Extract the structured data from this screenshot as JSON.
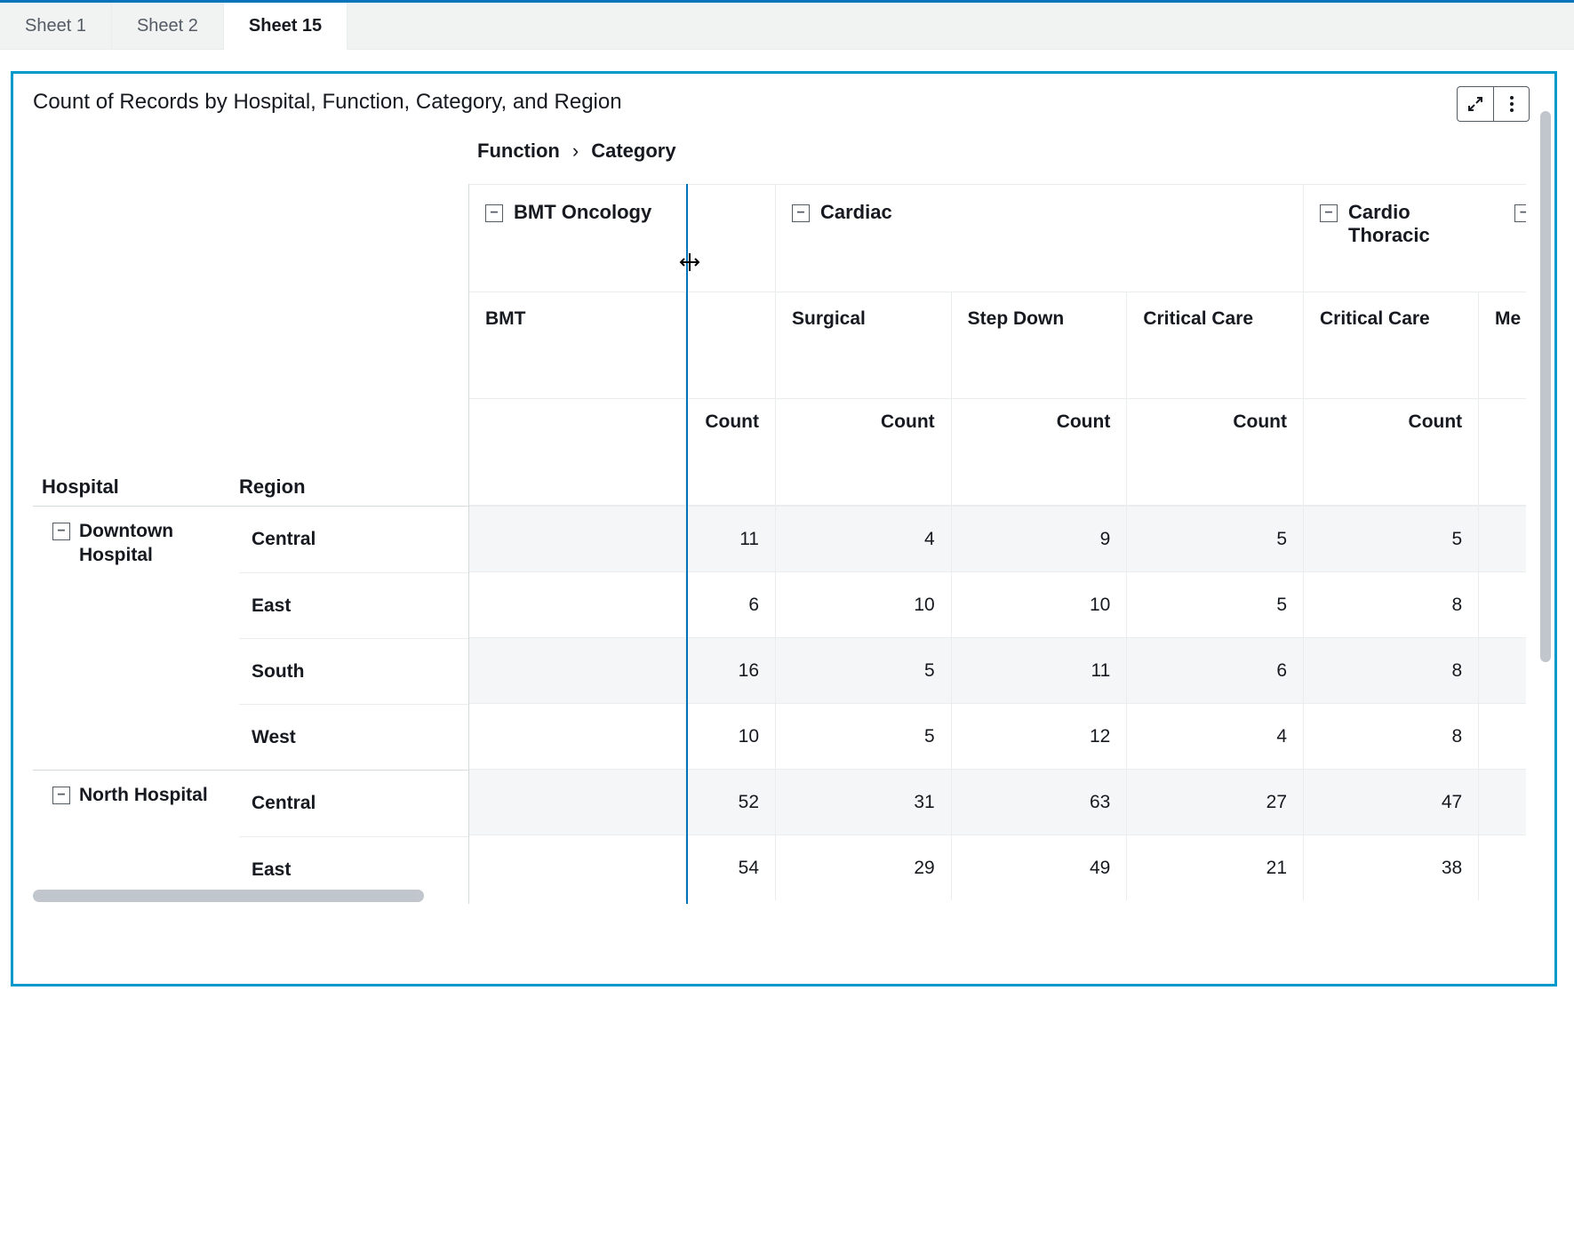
{
  "tabs": [
    "Sheet 1",
    "Sheet 2",
    "Sheet 15"
  ],
  "activeTab": 2,
  "visual": {
    "title": "Count of Records by Hospital, Function, Category, and Region",
    "colPath": [
      "Function",
      "Category"
    ],
    "rowPath": [
      "Hospital",
      "Region"
    ],
    "metricLabel": "Count"
  },
  "columns": [
    {
      "fn": "BMT Oncology",
      "cats": [
        "BMT"
      ]
    },
    {
      "fn": "Cardiac",
      "cats": [
        "Surgical",
        "Step Down",
        "Critical Care"
      ]
    },
    {
      "fn": "Cardio Thoracic",
      "cats": [
        "Critical Care",
        "Me"
      ]
    }
  ],
  "rows": [
    {
      "hospital": "Downtown Hospital",
      "regions": [
        "Central",
        "East",
        "South",
        "West"
      ]
    },
    {
      "hospital": "North Hospital",
      "regions": [
        "Central",
        "East"
      ]
    }
  ],
  "data": [
    [
      11,
      4,
      9,
      5,
      5
    ],
    [
      6,
      10,
      10,
      5,
      8
    ],
    [
      16,
      5,
      11,
      6,
      8
    ],
    [
      10,
      5,
      12,
      4,
      8
    ],
    [
      52,
      31,
      63,
      27,
      47
    ],
    [
      54,
      29,
      49,
      21,
      38
    ]
  ],
  "chart_data": {
    "type": "table",
    "row_dimensions": [
      "Hospital",
      "Region"
    ],
    "column_dimensions": [
      "Function",
      "Category"
    ],
    "metric": "Count",
    "columns": [
      {
        "function": "BMT Oncology",
        "category": "BMT"
      },
      {
        "function": "Cardiac",
        "category": "Surgical"
      },
      {
        "function": "Cardiac",
        "category": "Step Down"
      },
      {
        "function": "Cardiac",
        "category": "Critical Care"
      },
      {
        "function": "Cardio Thoracic",
        "category": "Critical Care"
      }
    ],
    "rows": [
      {
        "hospital": "Downtown Hospital",
        "region": "Central",
        "values": [
          11,
          4,
          9,
          5,
          5
        ]
      },
      {
        "hospital": "Downtown Hospital",
        "region": "East",
        "values": [
          6,
          10,
          10,
          5,
          8
        ]
      },
      {
        "hospital": "Downtown Hospital",
        "region": "South",
        "values": [
          16,
          5,
          11,
          6,
          8
        ]
      },
      {
        "hospital": "Downtown Hospital",
        "region": "West",
        "values": [
          10,
          5,
          12,
          4,
          8
        ]
      },
      {
        "hospital": "North Hospital",
        "region": "Central",
        "values": [
          52,
          31,
          63,
          27,
          47
        ]
      },
      {
        "hospital": "North Hospital",
        "region": "East",
        "values": [
          54,
          29,
          49,
          21,
          38
        ]
      }
    ]
  }
}
